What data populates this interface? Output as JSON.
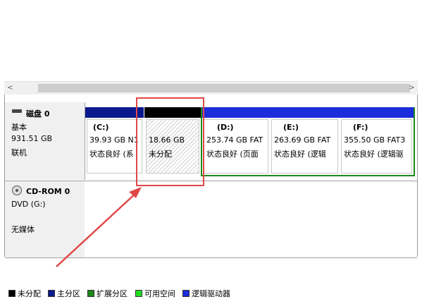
{
  "disk0": {
    "title": "磁盘 0",
    "type": "基本",
    "size": "931.51 GB",
    "status": "联机",
    "partitions": [
      {
        "label": "(C:)",
        "size": "39.93 GB N1",
        "status": "状态良好 (系",
        "color": "#0a1a8c"
      },
      {
        "label": "",
        "size": "18.66 GB",
        "status": "未分配",
        "color": "#000000"
      },
      {
        "label": "(D:)",
        "size": "253.74 GB FAT",
        "status": "状态良好 (页面",
        "color": "#1c2ddb"
      },
      {
        "label": "(E:)",
        "size": "263.69 GB FAT",
        "status": "状态良好 (逻辑",
        "color": "#1c2ddb"
      },
      {
        "label": "(F:)",
        "size": "355.50 GB FAT3",
        "status": "状态良好 (逻辑驱",
        "color": "#1c2ddb"
      }
    ]
  },
  "cdrom0": {
    "title": "CD-ROM 0",
    "type": "DVD (G:)",
    "media": "无媒体"
  },
  "legend": [
    {
      "label": "未分配",
      "color": "#000000"
    },
    {
      "label": "主分区",
      "color": "#0a1a8c"
    },
    {
      "label": "扩展分区",
      "color": "#1c8a1c"
    },
    {
      "label": "可用空间",
      "color": "#22dd22"
    },
    {
      "label": "逻辑驱动器",
      "color": "#1c2ddb"
    }
  ],
  "extended_partition_color": "#1c8a1c",
  "highlight_color": "#e04848"
}
